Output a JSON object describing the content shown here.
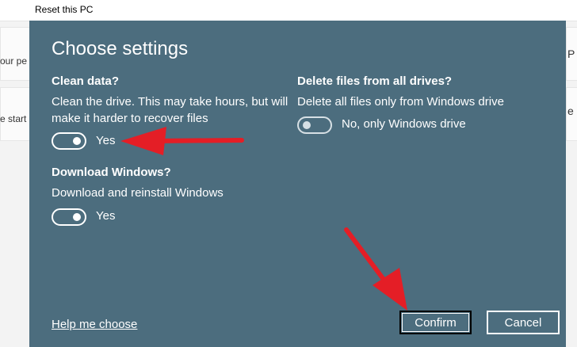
{
  "background": {
    "window_title": "Reset this PC",
    "fragments": [
      "our pe",
      "e start",
      "P",
      "e"
    ]
  },
  "dialog": {
    "title": "Choose settings",
    "clean_data": {
      "title": "Clean data?",
      "description_line1": "Clean the drive. This may take hours, but will",
      "description_line2": "make it harder to recover files",
      "toggle_state": "on",
      "toggle_label": "Yes"
    },
    "delete_files": {
      "title": "Delete files from all drives?",
      "description": "Delete all files only from Windows drive",
      "toggle_state": "off",
      "toggle_label": "No, only Windows drive"
    },
    "download_windows": {
      "title": "Download Windows?",
      "description": "Download and reinstall Windows",
      "toggle_state": "on",
      "toggle_label": "Yes"
    },
    "help_link": "Help me choose",
    "confirm_label": "Confirm",
    "cancel_label": "Cancel"
  },
  "colors": {
    "dialog_bg": "#4c6d7e",
    "arrow": "#e41e26"
  }
}
